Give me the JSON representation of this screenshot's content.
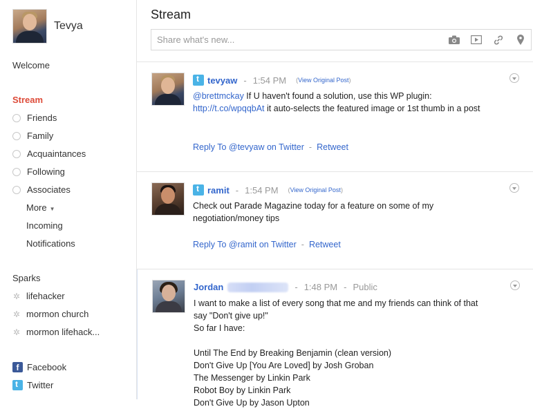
{
  "profile": {
    "name": "Tevya"
  },
  "nav": {
    "welcome": "Welcome",
    "stream": "Stream",
    "circles": [
      "Friends",
      "Family",
      "Acquaintances",
      "Following",
      "Associates"
    ],
    "more": "More",
    "more_caret": "▼",
    "incoming": "Incoming",
    "notifications": "Notifications"
  },
  "sparks": {
    "heading": "Sparks",
    "items": [
      "lifehacker",
      "mormon church",
      "mormon lifehack..."
    ]
  },
  "social": {
    "facebook": "Facebook",
    "facebook_glyph": "f",
    "twitter": "Twitter"
  },
  "main": {
    "title": "Stream",
    "share_placeholder": "Share what's new..."
  },
  "posts": [
    {
      "author": "tevyaw",
      "separator": "-",
      "time": "1:54 PM",
      "view_original": "View Original Post",
      "paren_open": "(",
      "paren_close": ")",
      "mention": "@brettmckay",
      "text_a": " If U haven't found a solution, use this WP plugin: ",
      "link": "http://t.co/wpqqbAt",
      "text_b": " it auto-selects the featured image or 1st thumb in a post",
      "reply": "Reply To @tevyaw on Twitter",
      "dot": "-",
      "retweet": "Retweet"
    },
    {
      "author": "ramit",
      "separator": "-",
      "time": "1:54 PM",
      "view_original": "View Original Post",
      "paren_open": "(",
      "paren_close": ")",
      "text": "Check out Parade Magazine today for a feature on some of my negotiation/money tips",
      "reply": "Reply To @ramit on Twitter",
      "dot": "-",
      "retweet": "Retweet"
    },
    {
      "author": "Jordan",
      "separator": "-",
      "time": "1:48 PM",
      "visibility": "Public",
      "lines": [
        "I want to make a list of every song that me and my friends can think of that say \"Don't give up!\"",
        "So far I have:",
        "",
        "Until The End by Breaking Benjamin (clean version)",
        "Don't Give Up [You Are Loved] by Josh Groban",
        "The Messenger by Linkin Park",
        "Robot Boy by Linkin Park",
        "Don't Give Up by Jason Upton"
      ]
    }
  ]
}
